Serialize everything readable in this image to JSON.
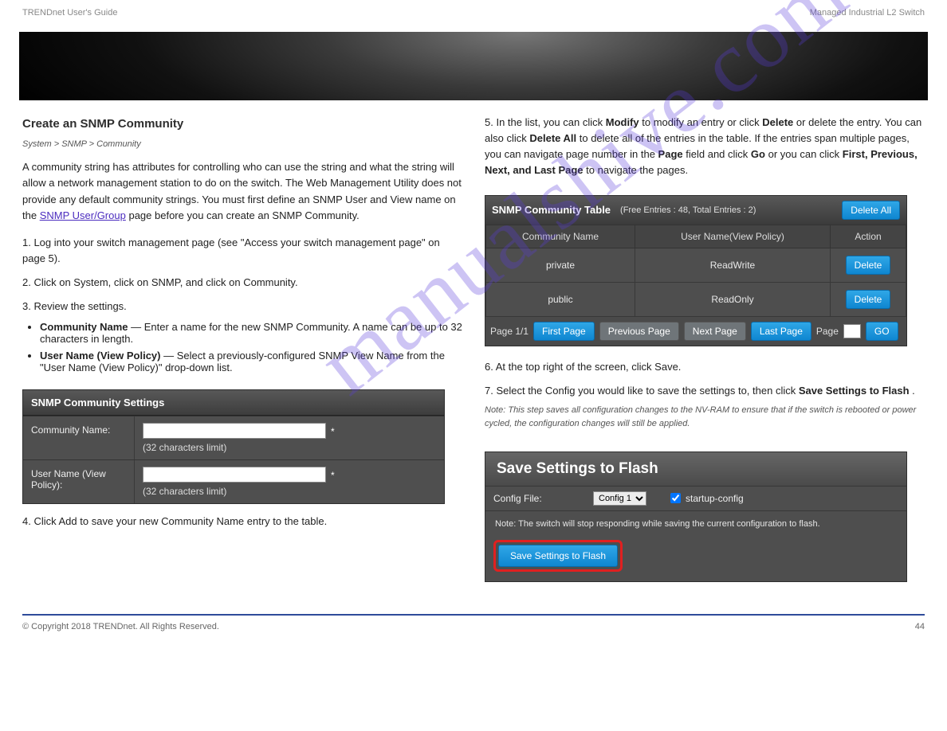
{
  "header": {
    "brand": "TRENDnet User's Guide",
    "product": "Managed Industrial L2 Switch"
  },
  "left": {
    "section_title": "Create an SNMP Community",
    "path": "System > SNMP > Community",
    "intro": "A community string has attributes for controlling who can use the string and what the string will allow a network management station to do on the switch. The Web Management Utility does not provide any default community strings. You must first define an SNMP User and View name on the",
    "link_text": "SNMP User/Group",
    "link_cont": " page before you can create an SNMP Community.",
    "steps_intro": "1. Log into your switch management page (see \"Access your switch management page\" on page 5).",
    "step2": "2. Click on System, click on SNMP, and click on Community.",
    "step3": "3. Review the settings.",
    "settings": {
      "panel_title": "SNMP Community Settings",
      "row1_label": "Community Name:",
      "row1_hint": "(32 characters limit)",
      "row2_label": "User Name (View Policy):",
      "row2_hint": "(32 characters limit)"
    },
    "bullets": {
      "b1_label": "Community Name",
      "b1_text": " — Enter a name for the new SNMP Community. A name can be up to 32 characters in length.",
      "b2_label": "User Name (View Policy)",
      "b2_text": " — Select a previously-configured SNMP View Name from the \"User Name (View Policy)\" drop-down list."
    },
    "click_add": "4. Click Add to save your new Community Name entry to the table."
  },
  "right": {
    "step5_a": "5. In the list, you can click ",
    "step5_modify": "Modify",
    "step5_b": " to modify an entry or click ",
    "step5_delete": "Delete",
    "step5_c": " or delete the entry. You can also click ",
    "step5_deleteall": "Delete All",
    "step5_d": " to delete all of the entries in the table. If the entries span multiple pages, you can navigate page number in the ",
    "step5_page": "Page",
    "step5_e": " field and click ",
    "step5_go": "Go",
    "step5_f": " or you can click ",
    "step5_nav": "First, Previous, Next, and Last Page",
    "step5_g": " to navigate the pages.",
    "table": {
      "title": "SNMP Community Table",
      "free": "(Free Entries : 48, Total Entries : 2)",
      "delete_all": "Delete All",
      "cols": [
        "Community Name",
        "User Name(View Policy)",
        "Action"
      ],
      "rows": [
        {
          "name": "private",
          "policy": "ReadWrite",
          "action": "Delete"
        },
        {
          "name": "public",
          "policy": "ReadOnly",
          "action": "Delete"
        }
      ],
      "pager": {
        "info": "Page 1/1",
        "first": "First Page",
        "prev": "Previous Page",
        "next": "Next Page",
        "last": "Last Page",
        "page_label": "Page",
        "go": "GO"
      }
    },
    "step6": "6. At the top right of the screen, click Save.",
    "step7_a": "7. Select the Config you would like to save the settings to, then click ",
    "step7_btn": "Save Settings to Flash",
    "step7_b": ".",
    "step7_note": "Note: This step saves all configuration changes to the NV-RAM to ensure that if the switch is rebooted or power cycled, the configuration changes will still be applied.",
    "save_panel": {
      "title": "Save Settings to Flash",
      "config_label": "Config File:",
      "config_value": "Config 1",
      "startup_label": "startup-config",
      "note": "Note: The switch will stop responding while saving the current configuration to flash.",
      "button": "Save Settings to Flash"
    }
  },
  "watermark": "manualshive.com",
  "footer": {
    "copyright": "© Copyright 2018 TRENDnet. All Rights Reserved.",
    "page_no": "44"
  }
}
